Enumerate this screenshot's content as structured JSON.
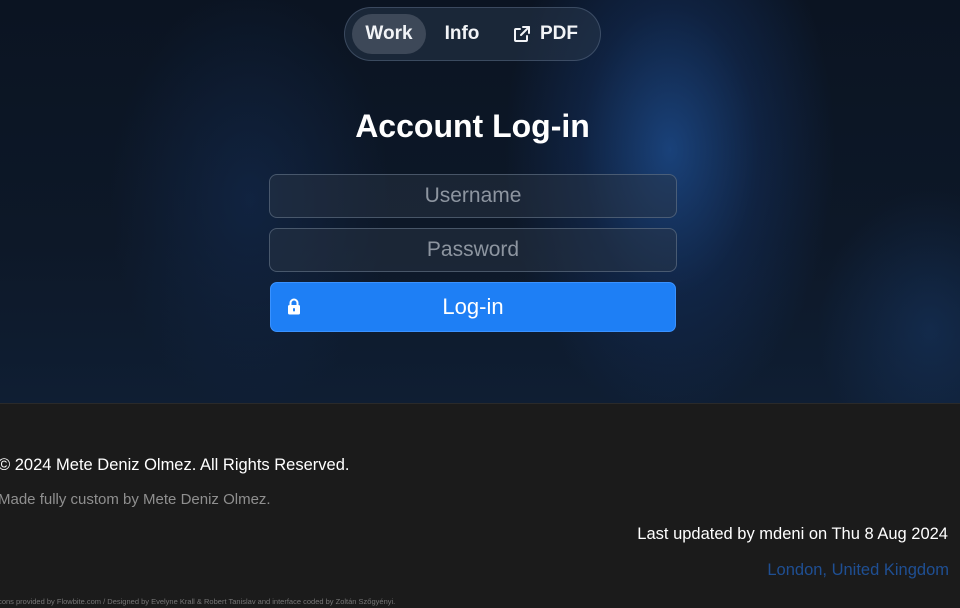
{
  "nav": {
    "items": [
      {
        "label": "Work",
        "active": true
      },
      {
        "label": "Info"
      },
      {
        "label": "PDF",
        "icon": "external-link-icon"
      }
    ]
  },
  "login": {
    "title": "Account Log-in",
    "username_placeholder": "Username",
    "password_placeholder": "Password",
    "button_label": "Log-in",
    "button_icon": "lock-icon",
    "button_color": "#1e7ff5"
  },
  "footer": {
    "copyright": "© 2024 Mete Deniz Olmez. All Rights Reserved.",
    "made_by": "Made fully custom by Mete Deniz Olmez.",
    "last_updated": "Last updated by mdeni on Thu 8 Aug 2024",
    "location": "London, United Kingdom",
    "credits": "Icons provided by Flowbite.com / Designed by Evelyne Krall & Robert Tanislav and interface coded by Zoltán Szőgyényi."
  }
}
